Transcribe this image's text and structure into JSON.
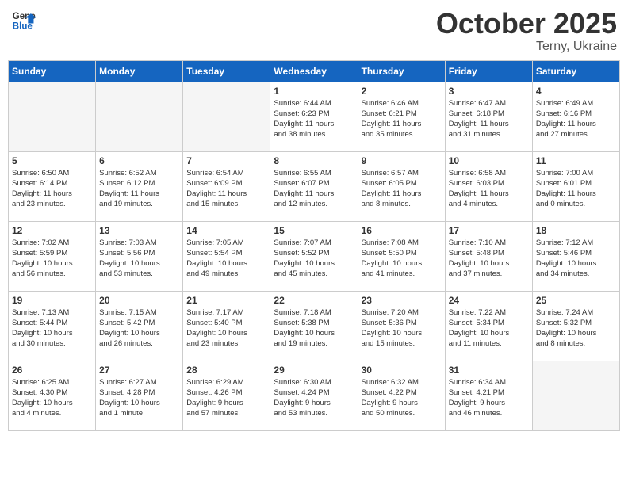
{
  "header": {
    "logo_line1": "General",
    "logo_line2": "Blue",
    "month": "October 2025",
    "location": "Terny, Ukraine"
  },
  "weekdays": [
    "Sunday",
    "Monday",
    "Tuesday",
    "Wednesday",
    "Thursday",
    "Friday",
    "Saturday"
  ],
  "weeks": [
    [
      {
        "day": "",
        "empty": true
      },
      {
        "day": "",
        "empty": true
      },
      {
        "day": "",
        "empty": true
      },
      {
        "day": "1",
        "line1": "Sunrise: 6:44 AM",
        "line2": "Sunset: 6:23 PM",
        "line3": "Daylight: 11 hours",
        "line4": "and 38 minutes."
      },
      {
        "day": "2",
        "line1": "Sunrise: 6:46 AM",
        "line2": "Sunset: 6:21 PM",
        "line3": "Daylight: 11 hours",
        "line4": "and 35 minutes."
      },
      {
        "day": "3",
        "line1": "Sunrise: 6:47 AM",
        "line2": "Sunset: 6:18 PM",
        "line3": "Daylight: 11 hours",
        "line4": "and 31 minutes."
      },
      {
        "day": "4",
        "line1": "Sunrise: 6:49 AM",
        "line2": "Sunset: 6:16 PM",
        "line3": "Daylight: 11 hours",
        "line4": "and 27 minutes."
      }
    ],
    [
      {
        "day": "5",
        "line1": "Sunrise: 6:50 AM",
        "line2": "Sunset: 6:14 PM",
        "line3": "Daylight: 11 hours",
        "line4": "and 23 minutes."
      },
      {
        "day": "6",
        "line1": "Sunrise: 6:52 AM",
        "line2": "Sunset: 6:12 PM",
        "line3": "Daylight: 11 hours",
        "line4": "and 19 minutes."
      },
      {
        "day": "7",
        "line1": "Sunrise: 6:54 AM",
        "line2": "Sunset: 6:09 PM",
        "line3": "Daylight: 11 hours",
        "line4": "and 15 minutes."
      },
      {
        "day": "8",
        "line1": "Sunrise: 6:55 AM",
        "line2": "Sunset: 6:07 PM",
        "line3": "Daylight: 11 hours",
        "line4": "and 12 minutes."
      },
      {
        "day": "9",
        "line1": "Sunrise: 6:57 AM",
        "line2": "Sunset: 6:05 PM",
        "line3": "Daylight: 11 hours",
        "line4": "and 8 minutes."
      },
      {
        "day": "10",
        "line1": "Sunrise: 6:58 AM",
        "line2": "Sunset: 6:03 PM",
        "line3": "Daylight: 11 hours",
        "line4": "and 4 minutes."
      },
      {
        "day": "11",
        "line1": "Sunrise: 7:00 AM",
        "line2": "Sunset: 6:01 PM",
        "line3": "Daylight: 11 hours",
        "line4": "and 0 minutes."
      }
    ],
    [
      {
        "day": "12",
        "line1": "Sunrise: 7:02 AM",
        "line2": "Sunset: 5:59 PM",
        "line3": "Daylight: 10 hours",
        "line4": "and 56 minutes."
      },
      {
        "day": "13",
        "line1": "Sunrise: 7:03 AM",
        "line2": "Sunset: 5:56 PM",
        "line3": "Daylight: 10 hours",
        "line4": "and 53 minutes."
      },
      {
        "day": "14",
        "line1": "Sunrise: 7:05 AM",
        "line2": "Sunset: 5:54 PM",
        "line3": "Daylight: 10 hours",
        "line4": "and 49 minutes."
      },
      {
        "day": "15",
        "line1": "Sunrise: 7:07 AM",
        "line2": "Sunset: 5:52 PM",
        "line3": "Daylight: 10 hours",
        "line4": "and 45 minutes."
      },
      {
        "day": "16",
        "line1": "Sunrise: 7:08 AM",
        "line2": "Sunset: 5:50 PM",
        "line3": "Daylight: 10 hours",
        "line4": "and 41 minutes."
      },
      {
        "day": "17",
        "line1": "Sunrise: 7:10 AM",
        "line2": "Sunset: 5:48 PM",
        "line3": "Daylight: 10 hours",
        "line4": "and 37 minutes."
      },
      {
        "day": "18",
        "line1": "Sunrise: 7:12 AM",
        "line2": "Sunset: 5:46 PM",
        "line3": "Daylight: 10 hours",
        "line4": "and 34 minutes."
      }
    ],
    [
      {
        "day": "19",
        "line1": "Sunrise: 7:13 AM",
        "line2": "Sunset: 5:44 PM",
        "line3": "Daylight: 10 hours",
        "line4": "and 30 minutes."
      },
      {
        "day": "20",
        "line1": "Sunrise: 7:15 AM",
        "line2": "Sunset: 5:42 PM",
        "line3": "Daylight: 10 hours",
        "line4": "and 26 minutes."
      },
      {
        "day": "21",
        "line1": "Sunrise: 7:17 AM",
        "line2": "Sunset: 5:40 PM",
        "line3": "Daylight: 10 hours",
        "line4": "and 23 minutes."
      },
      {
        "day": "22",
        "line1": "Sunrise: 7:18 AM",
        "line2": "Sunset: 5:38 PM",
        "line3": "Daylight: 10 hours",
        "line4": "and 19 minutes."
      },
      {
        "day": "23",
        "line1": "Sunrise: 7:20 AM",
        "line2": "Sunset: 5:36 PM",
        "line3": "Daylight: 10 hours",
        "line4": "and 15 minutes."
      },
      {
        "day": "24",
        "line1": "Sunrise: 7:22 AM",
        "line2": "Sunset: 5:34 PM",
        "line3": "Daylight: 10 hours",
        "line4": "and 11 minutes."
      },
      {
        "day": "25",
        "line1": "Sunrise: 7:24 AM",
        "line2": "Sunset: 5:32 PM",
        "line3": "Daylight: 10 hours",
        "line4": "and 8 minutes."
      }
    ],
    [
      {
        "day": "26",
        "line1": "Sunrise: 6:25 AM",
        "line2": "Sunset: 4:30 PM",
        "line3": "Daylight: 10 hours",
        "line4": "and 4 minutes."
      },
      {
        "day": "27",
        "line1": "Sunrise: 6:27 AM",
        "line2": "Sunset: 4:28 PM",
        "line3": "Daylight: 10 hours",
        "line4": "and 1 minute."
      },
      {
        "day": "28",
        "line1": "Sunrise: 6:29 AM",
        "line2": "Sunset: 4:26 PM",
        "line3": "Daylight: 9 hours",
        "line4": "and 57 minutes."
      },
      {
        "day": "29",
        "line1": "Sunrise: 6:30 AM",
        "line2": "Sunset: 4:24 PM",
        "line3": "Daylight: 9 hours",
        "line4": "and 53 minutes."
      },
      {
        "day": "30",
        "line1": "Sunrise: 6:32 AM",
        "line2": "Sunset: 4:22 PM",
        "line3": "Daylight: 9 hours",
        "line4": "and 50 minutes."
      },
      {
        "day": "31",
        "line1": "Sunrise: 6:34 AM",
        "line2": "Sunset: 4:21 PM",
        "line3": "Daylight: 9 hours",
        "line4": "and 46 minutes."
      },
      {
        "day": "",
        "empty": true
      }
    ]
  ]
}
